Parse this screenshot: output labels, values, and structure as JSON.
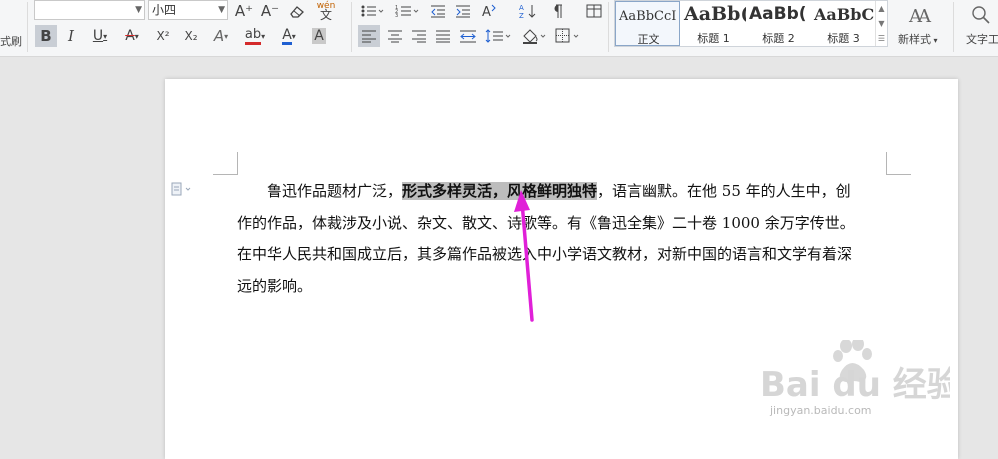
{
  "toolbar": {
    "left_cut_label": "式刷",
    "font_name": "",
    "font_size": "小四",
    "grow_font": "A⁺",
    "shrink_font": "A⁻",
    "clear_format": "⌫",
    "pinyin": "wén",
    "bold": "B",
    "italic": "I",
    "underline": "U",
    "strikethrough": "A",
    "superscript": "X²",
    "subscript": "X₂",
    "text_effect": "A",
    "highlight": "ab",
    "font_color": "A",
    "char_shading": "A",
    "accent_underline_red": "#d42b2b",
    "accent_font_blue": "#1e5fd1",
    "accent_active_bg": "#c9ced5"
  },
  "styles": {
    "items": [
      {
        "preview": "AaBbCcI",
        "name": "正文"
      },
      {
        "preview": "AaBb(",
        "name": "标题 1"
      },
      {
        "preview": "AaBb(",
        "name": "标题 2"
      },
      {
        "preview": "AaBbC",
        "name": "标题 3"
      }
    ],
    "new_style_label": "新样式",
    "text_tool_label": "文字工"
  },
  "document": {
    "lines": [
      {
        "before": "鲁迅作品题材广泛，",
        "highlight": "形式多样灵活，风格鲜明独特",
        "after": "，语言幽默。在他 55 年的人生中，创"
      },
      {
        "before": "作的作品，体裁涉及小说、杂文、散文、诗歌等。有《鲁迅全集》二十卷 1000 余万字传世。",
        "highlight": "",
        "after": ""
      },
      {
        "before": "在中华人民共和国成立后，其多篇作品被选入中小学语文教材，对新中国的语言和文学有着深",
        "highlight": "",
        "after": ""
      },
      {
        "before": "远的影响。",
        "highlight": "",
        "after": ""
      }
    ],
    "annotation_arrow_color": "#e020d8"
  },
  "watermark": {
    "brand_text": "Bai du 经验",
    "url": "jingyan.baidu.com"
  }
}
